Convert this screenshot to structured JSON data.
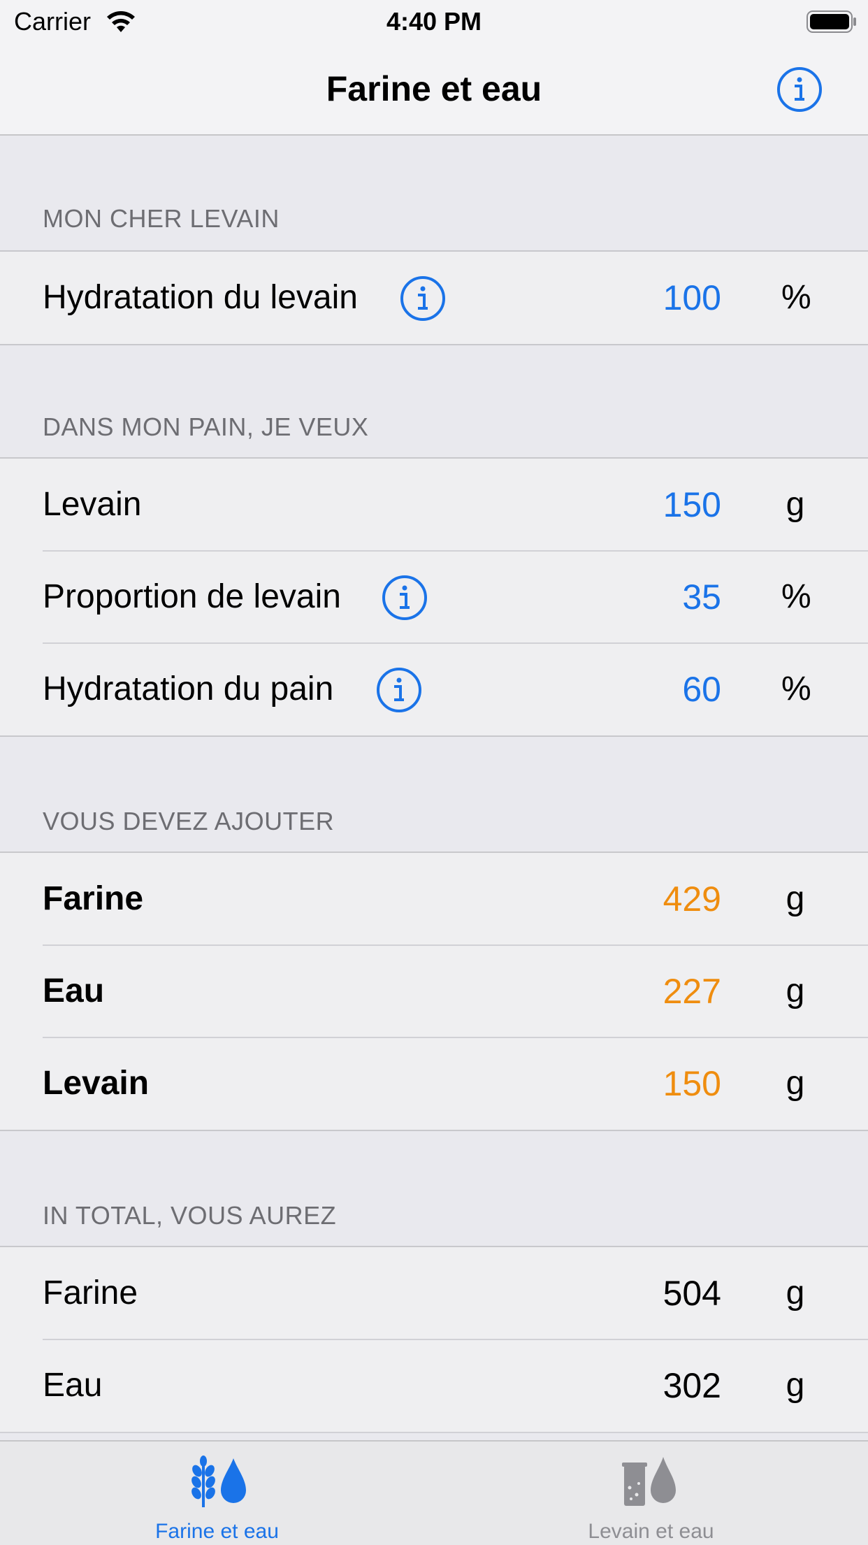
{
  "status_bar": {
    "carrier": "Carrier",
    "time": "4:40 PM"
  },
  "nav": {
    "title": "Farine et eau"
  },
  "sections": [
    {
      "header": "MON CHER LEVAIN",
      "rows": [
        {
          "label": "Hydratation du levain",
          "info": true,
          "value": "100",
          "unit": "%"
        }
      ]
    },
    {
      "header": "DANS MON PAIN, JE VEUX",
      "rows": [
        {
          "label": "Levain",
          "info": false,
          "value": "150",
          "unit": "g"
        },
        {
          "label": "Proportion de levain",
          "info": true,
          "value": "35",
          "unit": "%"
        },
        {
          "label": "Hydratation du pain",
          "info": true,
          "value": "60",
          "unit": "%"
        }
      ]
    },
    {
      "header": "VOUS DEVEZ AJOUTER",
      "rows": [
        {
          "label": "Farine",
          "value": "429",
          "unit": "g"
        },
        {
          "label": "Eau",
          "value": "227",
          "unit": "g"
        },
        {
          "label": "Levain",
          "value": "150",
          "unit": "g"
        }
      ]
    },
    {
      "header": "IN TOTAL, VOUS AUREZ",
      "rows": [
        {
          "label": "Farine",
          "value": "504",
          "unit": "g"
        },
        {
          "label": "Eau",
          "value": "302",
          "unit": "g"
        }
      ]
    }
  ],
  "tabs": [
    {
      "label": "Farine et eau",
      "icon": "wheat-drop-icon",
      "selected": true
    },
    {
      "label": "Levain et eau",
      "icon": "jar-drop-icon",
      "selected": false
    }
  ],
  "colors": {
    "accent": "#1a73e8",
    "result": "#ef8d0f",
    "inactive": "#8e8e93"
  }
}
